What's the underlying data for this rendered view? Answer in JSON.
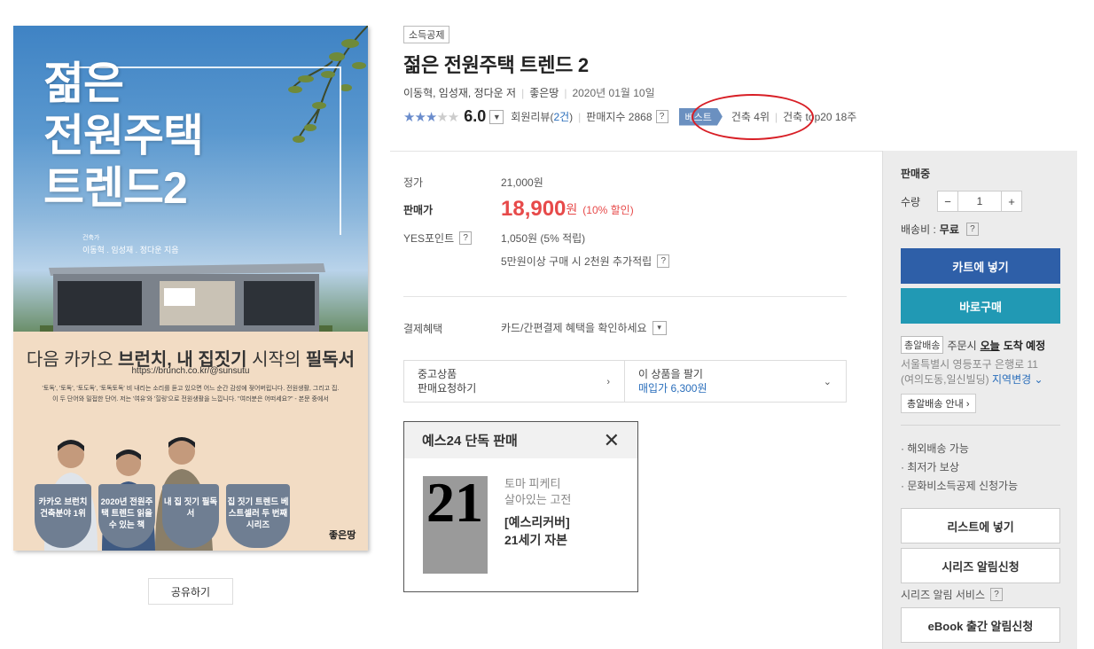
{
  "cover": {
    "title_line1": "젊은",
    "title_line2": "전원주택",
    "title_line3": "트렌드2",
    "authors_label": "건축가",
    "authors": "이동혁 . 임성재 . 정다운 지음",
    "tagline_pre": "다음 카카오 ",
    "tagline_bold": "브런치, 내 집짓기",
    "tagline_mid": " 시작의 ",
    "tagline_bold2": "필독서",
    "url": "https://brunch.co.kr/@sunsutu",
    "quote": "'토독', '토독', '토도독', '토독토독' 비 내리는 소리를 듣고 있으면 어느 순간 감성에 젖어버립니다. 전원생활, 그리고 집. 이 두 단어와 밀접한 단어. 저는 '여유'와 '힐링'으로 전원생활을 느낍니다. \"여러분은 어떠세요?\" - 본문 중에서",
    "badges": [
      "카카오 브런치 건축분야 1위",
      "2020년 전원주택 트렌드 읽을 수 있는 책",
      "내 집 짓기 필독서",
      "집 짓기 트렌드 베스트셀러 두 번째 시리즈"
    ],
    "publisher_logo": "좋은땅"
  },
  "share_label": "공유하기",
  "product": {
    "category": "소득공제",
    "title": "젊은 전원주택 트렌드 2",
    "authors": "이동혁, 임성재, 정다운 저",
    "publisher": "좋은땅",
    "date": "2020년 01월 10일",
    "stars_on": 3,
    "stars_total": 5,
    "score": "6.0",
    "review_label": "회원리뷰(",
    "review_count": "2건",
    "review_close": ")",
    "sales_index_label": "판매지수 2868",
    "best_label": "베스트",
    "rank_text": "건축 4위",
    "top20_text": "건축 top20 18주"
  },
  "price": {
    "list_label": "정가",
    "list_value": "21,000원",
    "sale_label": "판매가",
    "sale_value": "18,900",
    "sale_won": "원",
    "sale_discount": "(10% 할인)",
    "points_label": "YES포인트",
    "points_value": "1,050원 (5% 적립)",
    "extra_points": "5만원이상 구매 시 2천원 추가적립",
    "payment_label": "결제혜택",
    "payment_value": "카드/간편결제 혜택을 확인하세요"
  },
  "used": {
    "left_line1": "중고상품",
    "left_line2": "판매요청하기",
    "right_line1": "이 상품을 팔기",
    "right_line2": "매입가 6,300원"
  },
  "exclusive": {
    "header": "예스24 단독 판매",
    "subtitle_line1": "토마 피케티",
    "subtitle_line2": "살아있는 고전",
    "name_line1": "[예스리커버]",
    "name_line2": "21세기 자본",
    "book_cover_text": "21"
  },
  "panel": {
    "status": "판매중",
    "qty_label": "수량",
    "qty_value": "1",
    "shipping_label": "배송비 :",
    "shipping_value": "무료",
    "cart_button": "카트에 넣기",
    "buy_button": "바로구매",
    "delivery_tag": "총알배송",
    "delivery_pre": "주문시",
    "delivery_day": "오늘",
    "delivery_post": "도착 예정",
    "address_line1": "서울특별시 영등포구 은행로 11",
    "address_line2": "(여의도동,일신빌딩)",
    "change_region": "지역변경",
    "delivery_guide": "총알배송 안내",
    "benefits": [
      "· 해외배송 가능",
      "· 최저가 보상",
      "· 문화비소득공제 신청가능"
    ],
    "list_button": "리스트에 넣기",
    "series_button": "시리즈 알림신청",
    "series_note": "시리즈 알림 서비스",
    "ebook_button": "eBook 출간 알림신청"
  },
  "colors": {
    "cart_blue": "#2e5fa8",
    "buy_teal": "#2199b4",
    "sale_red": "#e74a4a",
    "best_blue": "#6b90c0",
    "annotation_red": "#d81f26"
  }
}
